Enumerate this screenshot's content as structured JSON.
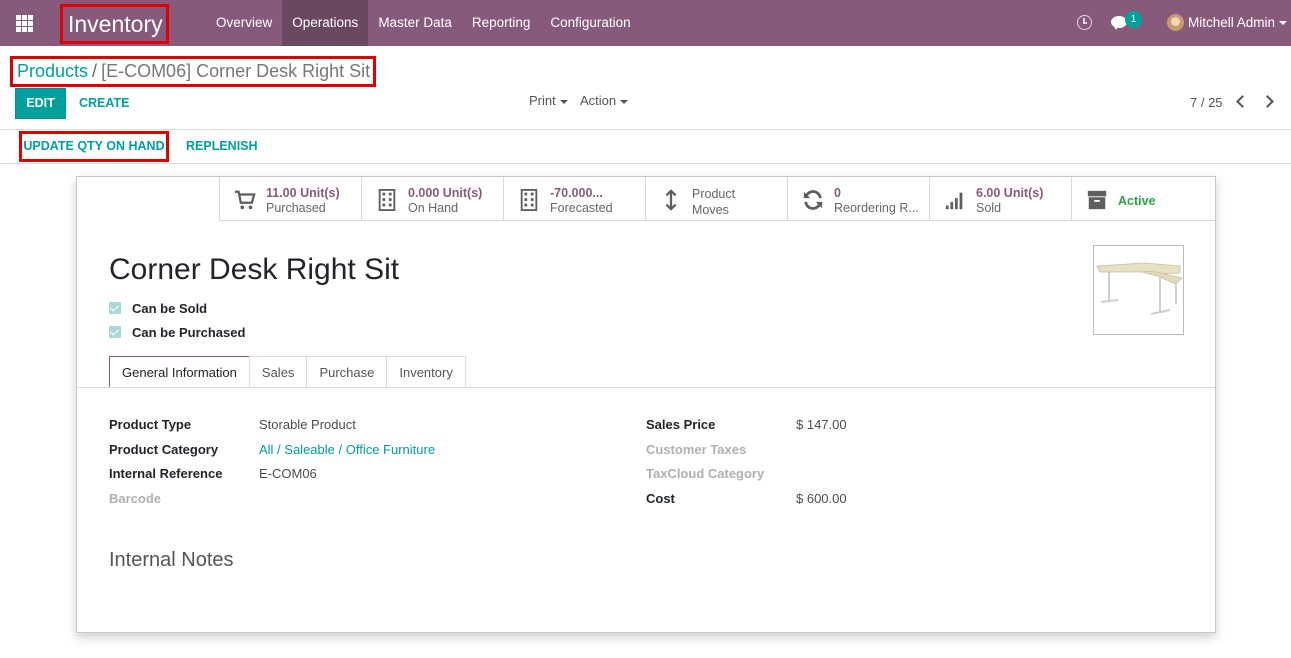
{
  "navbar": {
    "app_name": "Inventory",
    "menu": [
      "Overview",
      "Operations",
      "Master Data",
      "Reporting",
      "Configuration"
    ],
    "active_menu": "Operations",
    "chat_count": "1",
    "user": "Mitchell Admin",
    "bg_color": "#875a7b"
  },
  "control_panel": {
    "breadcrumb_parent": "Products",
    "breadcrumb_sep": "/",
    "breadcrumb_current": "[E-COM06] Corner Desk Right Sit",
    "edit_label": "EDIT",
    "create_label": "CREATE",
    "print_label": "Print",
    "action_label": "Action",
    "pager": "7 / 25"
  },
  "statusbar": {
    "update_qty_label": "UPDATE QTY ON HAND",
    "replenish_label": "REPLENISH"
  },
  "smart_buttons": {
    "purchased": {
      "value": "11.00 Unit(s)",
      "label": "Purchased",
      "icon": "cart-icon"
    },
    "on_hand": {
      "value": "0.000 Unit(s)",
      "label": "On Hand",
      "icon": "building-icon"
    },
    "forecasted": {
      "value": "-70.000...",
      "label": "Forecasted",
      "icon": "building-icon"
    },
    "moves": {
      "line1": "Product",
      "line2": "Moves",
      "icon": "arrows-vertical-icon"
    },
    "reordering": {
      "value": "0",
      "label": "Reordering R...",
      "icon": "refresh-icon"
    },
    "sold": {
      "value": "6.00 Unit(s)",
      "label": "Sold",
      "icon": "signal-icon"
    },
    "active": {
      "label": "Active",
      "icon": "archive-icon"
    }
  },
  "product": {
    "name": "Corner Desk Right Sit",
    "can_be_sold": "Can be Sold",
    "can_be_purchased": "Can be Purchased"
  },
  "tabs": [
    "General Information",
    "Sales",
    "Purchase",
    "Inventory"
  ],
  "fields": {
    "product_type_label": "Product Type",
    "product_type_value": "Storable Product",
    "product_category_label": "Product Category",
    "product_category_value": "All / Saleable / Office Furniture",
    "internal_ref_label": "Internal Reference",
    "internal_ref_value": "E-COM06",
    "barcode_label": "Barcode",
    "sales_price_label": "Sales Price",
    "sales_price_value": "$ 147.00",
    "customer_taxes_label": "Customer Taxes",
    "taxcloud_label": "TaxCloud Category",
    "cost_label": "Cost",
    "cost_value": "$ 600.00"
  },
  "notes_title": "Internal Notes"
}
